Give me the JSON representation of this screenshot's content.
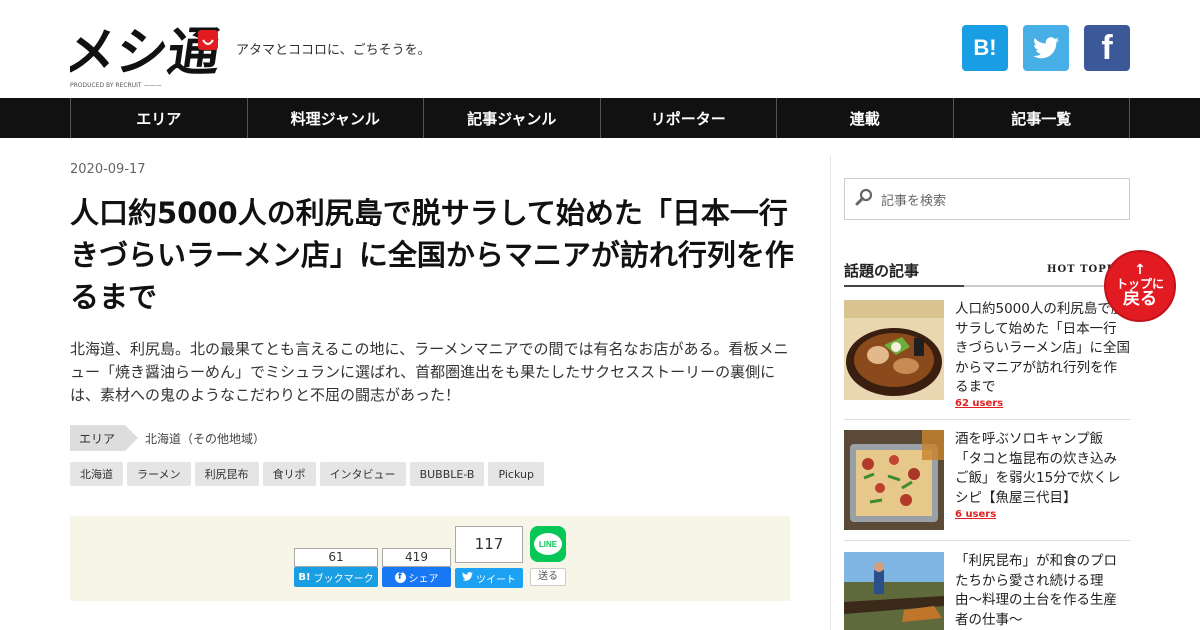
{
  "site": {
    "tagline": "アタマとココロに、ごちそうを。",
    "logo_text": "メシ通",
    "logo_produced": "PRODUCED BY RECRUIT"
  },
  "social": {
    "hatena_label": "B!",
    "facebook_label": "f"
  },
  "nav": [
    "エリア",
    "料理ジャンル",
    "記事ジャンル",
    "リポーター",
    "連載",
    "記事一覧"
  ],
  "article": {
    "date": "2020-09-17",
    "title": "人口約5000人の利尻島で脱サラして始めた「日本一行きづらいラーメン店」に全国からマニアが訪れ行列を作るまで",
    "lead": "北海道、利尻島。北の最果てとも言えるこの地に、ラーメンマニアでの間では有名なお店がある。看板メニュー「焼き醤油らーめん」でミシュランに選ばれ、首都圏進出をも果たしたサクセスストーリーの裏側には、素材への鬼のようなこだわりと不屈の闘志があった！",
    "area_label": "エリア",
    "area_value": "北海道（その他地域）",
    "tags": [
      "北海道",
      "ラーメン",
      "利尻昆布",
      "食リポ",
      "インタビュー",
      "BUBBLE-B",
      "Pickup"
    ]
  },
  "share": {
    "hatena_count": "61",
    "hatena_label": "ブックマーク",
    "facebook_count": "419",
    "facebook_label": "シェア",
    "twitter_count": "117",
    "twitter_label": "ツイート",
    "line_label": "LINE",
    "line_send": "送る"
  },
  "sidebar": {
    "search_placeholder": "記事を検索",
    "hot_title": "話題の記事",
    "hot_sub": "HOT TOPICS",
    "articles": [
      {
        "title": "人口約5000人の利尻島で脱サラして始めた「日本一行きづらいラーメン店」に全国からマニアが訪れ行列を作るまで",
        "users": "62 users"
      },
      {
        "title": "酒を呼ぶソロキャンプ飯「タコと塩昆布の炊き込みご飯」を弱火15分で炊くレシピ【魚屋三代目】",
        "users": "6 users"
      },
      {
        "title": "「利尻昆布」が和食のプロたちから愛され続ける理由〜料理の土台を作る生産者の仕事〜",
        "users": ""
      }
    ]
  },
  "totop": {
    "line1": "トップに",
    "line2": "戻る"
  },
  "colors": {
    "nav_bg": "#111111",
    "accent_red": "#e21b22",
    "share_bg": "#f7f4e8",
    "hatena": "#1a9ee3",
    "twitter": "#48aee6",
    "facebook": "#3b5998",
    "line": "#06c755"
  }
}
